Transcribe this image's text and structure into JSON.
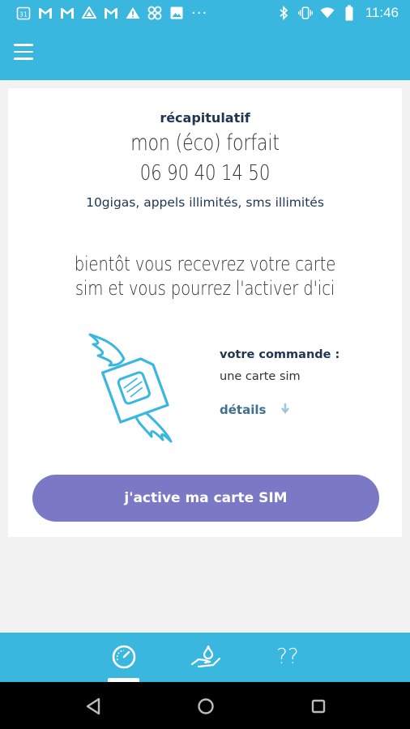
{
  "status_bar": {
    "time": "11:46",
    "left_icons": [
      "calendar-icon",
      "gmail-icon",
      "gmail-icon",
      "drive-icon",
      "gmail-icon",
      "warning-icon",
      "pinwheel-icon",
      "image-icon"
    ],
    "calendar_day": "31",
    "more": "···",
    "right_icons": [
      "bluetooth-icon",
      "vibrate-icon",
      "wifi-icon",
      "battery-icon"
    ]
  },
  "app_bar": {
    "menu_icon": "hamburger-menu-icon"
  },
  "summary": {
    "title": "récapitulatif",
    "plan_name": "mon (éco) forfait",
    "phone_number": "06 90 40 14 50",
    "features": "10gigas, appels illimités, sms illimités"
  },
  "message": {
    "line1": "bientôt vous recevrez votre carte",
    "line2": "sim et vous pourrez l'activer d'ici"
  },
  "order": {
    "label": "votre commande :",
    "value": "une carte sim",
    "details_label": "détails",
    "details_icon": "arrow-down-icon"
  },
  "cta": {
    "label": "j'active ma carte SIM"
  },
  "bottom_nav": {
    "items": [
      "speedometer-icon",
      "hand-drop-icon",
      "help-icon"
    ],
    "help_text": "??",
    "active_index": 0
  },
  "system_nav": {
    "back": "back-icon",
    "home": "home-icon",
    "recents": "recents-icon"
  },
  "colors": {
    "primary": "#3ab7df",
    "button": "#7b79c6",
    "navy_text": "#1f3552",
    "background": "#f2f2f2"
  }
}
